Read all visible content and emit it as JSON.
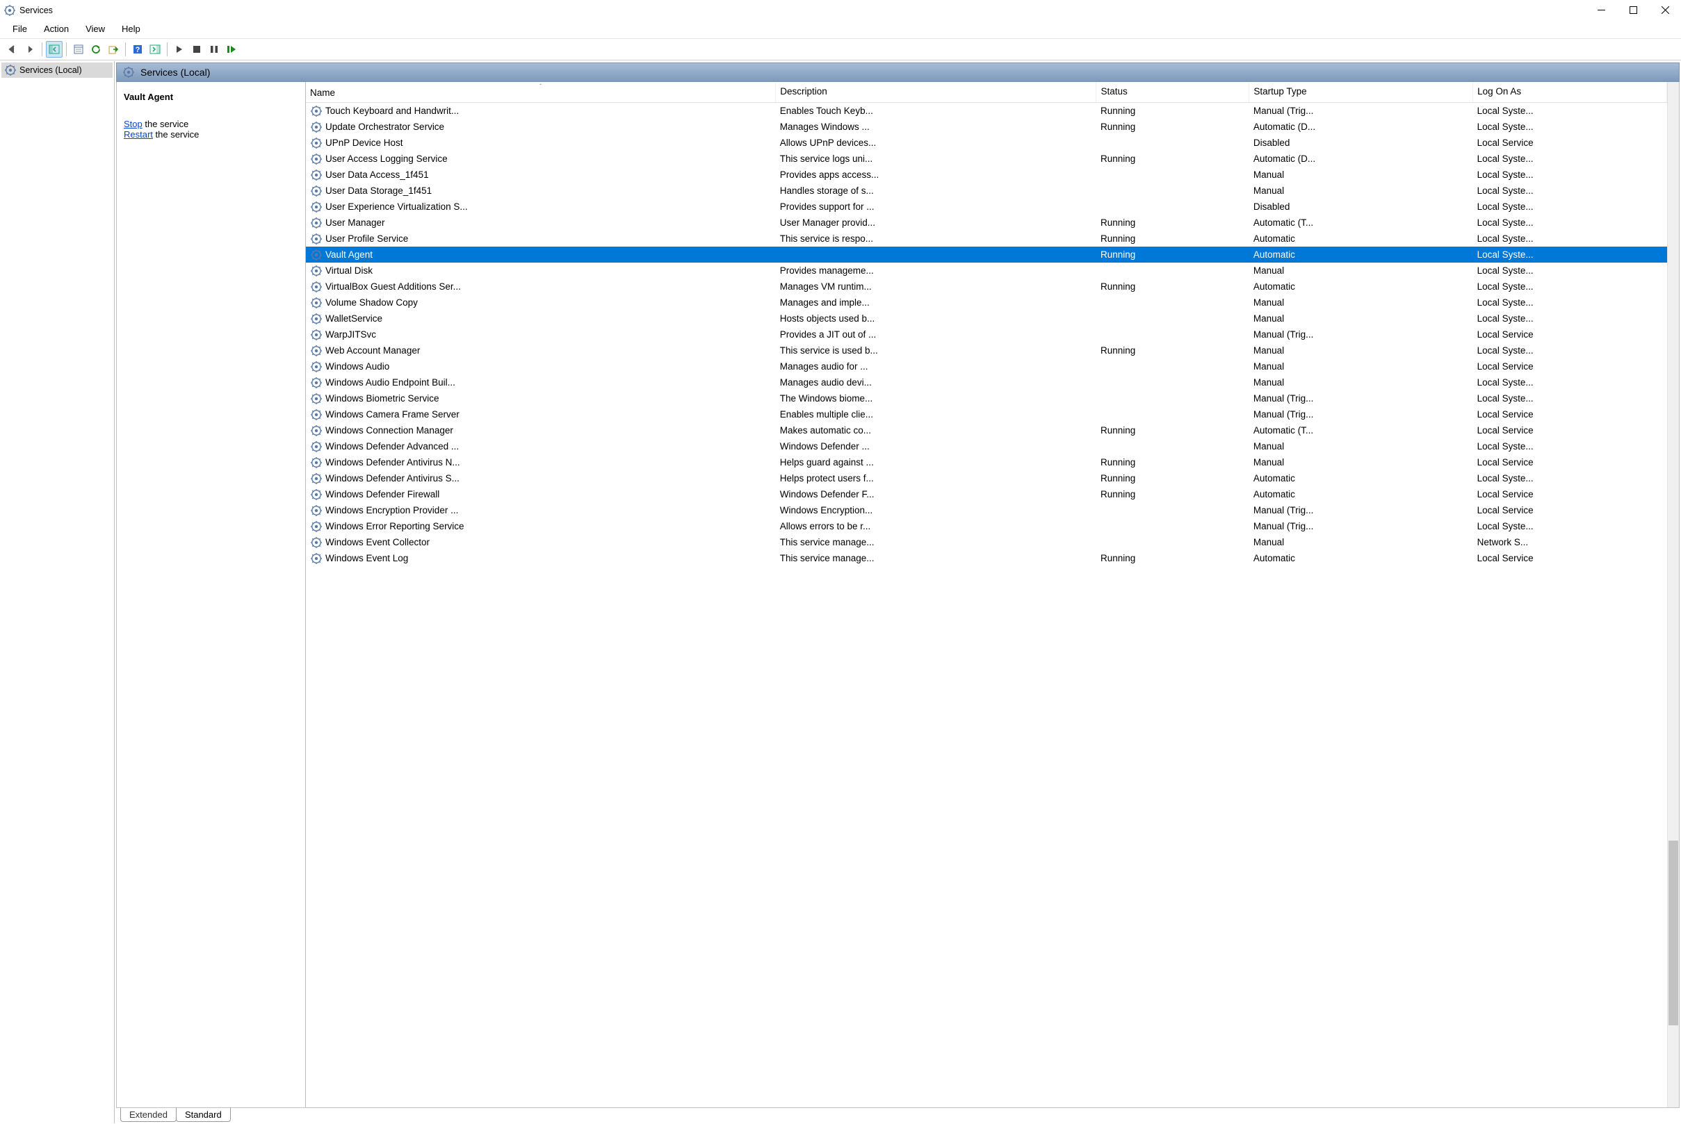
{
  "window": {
    "title": "Services"
  },
  "menu": {
    "file": "File",
    "action": "Action",
    "view": "View",
    "help": "Help"
  },
  "tree": {
    "root": "Services (Local)"
  },
  "panel_header": "Services (Local)",
  "detail": {
    "title": "Vault Agent",
    "stop_link": "Stop",
    "stop_rest": " the service",
    "restart_link": "Restart",
    "restart_rest": " the service"
  },
  "columns": {
    "name": "Name",
    "description": "Description",
    "status": "Status",
    "startup": "Startup Type",
    "logon": "Log On As"
  },
  "tabs": {
    "extended": "Extended",
    "standard": "Standard"
  },
  "services": [
    {
      "name": "Touch Keyboard and Handwrit...",
      "desc": "Enables Touch Keyb...",
      "status": "Running",
      "startup": "Manual (Trig...",
      "logon": "Local Syste...",
      "sel": false
    },
    {
      "name": "Update Orchestrator Service",
      "desc": "Manages Windows ...",
      "status": "Running",
      "startup": "Automatic (D...",
      "logon": "Local Syste...",
      "sel": false
    },
    {
      "name": "UPnP Device Host",
      "desc": "Allows UPnP devices...",
      "status": "",
      "startup": "Disabled",
      "logon": "Local Service",
      "sel": false
    },
    {
      "name": "User Access Logging Service",
      "desc": "This service logs uni...",
      "status": "Running",
      "startup": "Automatic (D...",
      "logon": "Local Syste...",
      "sel": false
    },
    {
      "name": "User Data Access_1f451",
      "desc": "Provides apps access...",
      "status": "",
      "startup": "Manual",
      "logon": "Local Syste...",
      "sel": false
    },
    {
      "name": "User Data Storage_1f451",
      "desc": "Handles storage of s...",
      "status": "",
      "startup": "Manual",
      "logon": "Local Syste...",
      "sel": false
    },
    {
      "name": "User Experience Virtualization S...",
      "desc": "Provides support for ...",
      "status": "",
      "startup": "Disabled",
      "logon": "Local Syste...",
      "sel": false
    },
    {
      "name": "User Manager",
      "desc": "User Manager provid...",
      "status": "Running",
      "startup": "Automatic (T...",
      "logon": "Local Syste...",
      "sel": false
    },
    {
      "name": "User Profile Service",
      "desc": "This service is respo...",
      "status": "Running",
      "startup": "Automatic",
      "logon": "Local Syste...",
      "sel": false
    },
    {
      "name": "Vault Agent",
      "desc": "",
      "status": "Running",
      "startup": "Automatic",
      "logon": "Local Syste...",
      "sel": true
    },
    {
      "name": "Virtual Disk",
      "desc": "Provides manageme...",
      "status": "",
      "startup": "Manual",
      "logon": "Local Syste...",
      "sel": false
    },
    {
      "name": "VirtualBox Guest Additions Ser...",
      "desc": "Manages VM runtim...",
      "status": "Running",
      "startup": "Automatic",
      "logon": "Local Syste...",
      "sel": false
    },
    {
      "name": "Volume Shadow Copy",
      "desc": "Manages and imple...",
      "status": "",
      "startup": "Manual",
      "logon": "Local Syste...",
      "sel": false
    },
    {
      "name": "WalletService",
      "desc": "Hosts objects used b...",
      "status": "",
      "startup": "Manual",
      "logon": "Local Syste...",
      "sel": false
    },
    {
      "name": "WarpJITSvc",
      "desc": "Provides a JIT out of ...",
      "status": "",
      "startup": "Manual (Trig...",
      "logon": "Local Service",
      "sel": false
    },
    {
      "name": "Web Account Manager",
      "desc": "This service is used b...",
      "status": "Running",
      "startup": "Manual",
      "logon": "Local Syste...",
      "sel": false
    },
    {
      "name": "Windows Audio",
      "desc": "Manages audio for ...",
      "status": "",
      "startup": "Manual",
      "logon": "Local Service",
      "sel": false
    },
    {
      "name": "Windows Audio Endpoint Buil...",
      "desc": "Manages audio devi...",
      "status": "",
      "startup": "Manual",
      "logon": "Local Syste...",
      "sel": false
    },
    {
      "name": "Windows Biometric Service",
      "desc": "The Windows biome...",
      "status": "",
      "startup": "Manual (Trig...",
      "logon": "Local Syste...",
      "sel": false
    },
    {
      "name": "Windows Camera Frame Server",
      "desc": "Enables multiple clie...",
      "status": "",
      "startup": "Manual (Trig...",
      "logon": "Local Service",
      "sel": false
    },
    {
      "name": "Windows Connection Manager",
      "desc": "Makes automatic co...",
      "status": "Running",
      "startup": "Automatic (T...",
      "logon": "Local Service",
      "sel": false
    },
    {
      "name": "Windows Defender Advanced ...",
      "desc": "Windows Defender ...",
      "status": "",
      "startup": "Manual",
      "logon": "Local Syste...",
      "sel": false
    },
    {
      "name": "Windows Defender Antivirus N...",
      "desc": "Helps guard against ...",
      "status": "Running",
      "startup": "Manual",
      "logon": "Local Service",
      "sel": false
    },
    {
      "name": "Windows Defender Antivirus S...",
      "desc": "Helps protect users f...",
      "status": "Running",
      "startup": "Automatic",
      "logon": "Local Syste...",
      "sel": false
    },
    {
      "name": "Windows Defender Firewall",
      "desc": "Windows Defender F...",
      "status": "Running",
      "startup": "Automatic",
      "logon": "Local Service",
      "sel": false
    },
    {
      "name": "Windows Encryption Provider ...",
      "desc": "Windows Encryption...",
      "status": "",
      "startup": "Manual (Trig...",
      "logon": "Local Service",
      "sel": false
    },
    {
      "name": "Windows Error Reporting Service",
      "desc": "Allows errors to be r...",
      "status": "",
      "startup": "Manual (Trig...",
      "logon": "Local Syste...",
      "sel": false
    },
    {
      "name": "Windows Event Collector",
      "desc": "This service manage...",
      "status": "",
      "startup": "Manual",
      "logon": "Network S...",
      "sel": false
    },
    {
      "name": "Windows Event Log",
      "desc": "This service manage...",
      "status": "Running",
      "startup": "Automatic",
      "logon": "Local Service",
      "sel": false
    }
  ]
}
